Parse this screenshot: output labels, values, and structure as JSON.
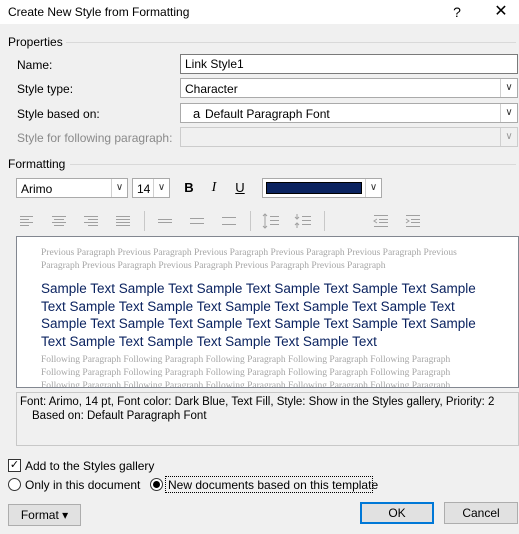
{
  "window": {
    "title": "Create New Style from Formatting",
    "help_label": "?",
    "close_label": "✕"
  },
  "properties": {
    "section_label": "Properties",
    "name_label": "Name:",
    "name_value": "Link Style1",
    "style_type_label": "Style type:",
    "style_type_value": "Character",
    "based_on_label": "Style based on:",
    "based_on_icon": "a",
    "based_on_value": "Default Paragraph Font",
    "following_label": "Style for following paragraph:",
    "following_value": ""
  },
  "formatting": {
    "section_label": "Formatting",
    "font_value": "Arimo",
    "size_value": "14",
    "bold_label": "B",
    "italic_label": "I",
    "underline_label": "U",
    "font_color": "#0b2360"
  },
  "preview": {
    "previous_line1": "Previous Paragraph Previous Paragraph Previous Paragraph Previous Paragraph Previous Paragraph Previous",
    "previous_line2": "Paragraph Previous Paragraph Previous Paragraph Previous Paragraph Previous Paragraph",
    "sample_line1": "Sample Text Sample Text Sample Text Sample Text Sample Text Sample",
    "sample_line2": "Text Sample Text Sample Text Sample Text Sample Text Sample Text",
    "sample_line3": "Sample Text Sample Text Sample Text Sample Text Sample Text Sample",
    "sample_line4": "Text Sample Text Sample Text Sample Text Sample Text",
    "following_line1": "Following Paragraph Following Paragraph Following Paragraph Following Paragraph Following Paragraph",
    "following_line2": "Following Paragraph Following Paragraph Following Paragraph Following Paragraph Following Paragraph",
    "following_line3": "Following Paragraph Following Paragraph Following Paragraph Following Paragraph Following Paragraph"
  },
  "description": {
    "line1": "Font: Arimo, 14 pt, Font color: Dark Blue, Text Fill, Style: Show in the Styles gallery, Priority: 2",
    "line2": "Based on: Default Paragraph Font"
  },
  "options": {
    "add_to_gallery_label": "Add to the Styles gallery",
    "add_to_gallery_checked": true,
    "only_this_document_label": "Only in this document",
    "new_documents_label": "New documents based on this template"
  },
  "buttons": {
    "format_label": "Format ▾",
    "ok_label": "OK",
    "cancel_label": "Cancel"
  }
}
